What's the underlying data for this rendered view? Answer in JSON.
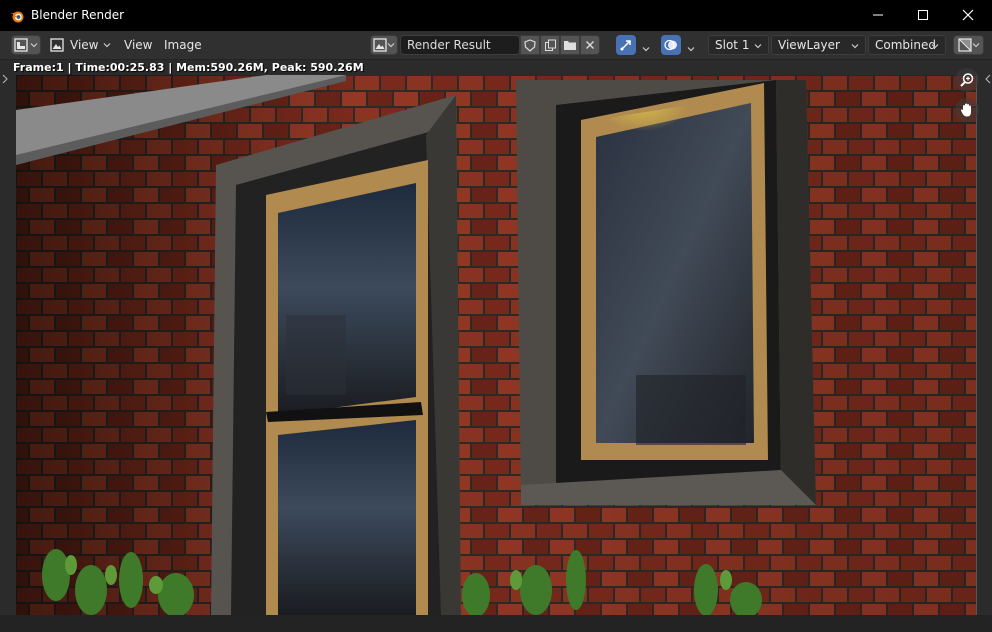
{
  "window": {
    "title": "Blender Render",
    "controls": [
      "minimize",
      "maximize",
      "close"
    ]
  },
  "header": {
    "editor_type_icon": "image-editor-icon",
    "view_mode_label": "View",
    "menus": [
      "View",
      "Image"
    ],
    "image_name": "Render Result",
    "slot": "Slot 1",
    "view_layer": "ViewLayer",
    "pass": "Combined"
  },
  "stats_text": "Frame:1 | Time:00:25.83 | Mem:590.26M, Peak: 590.26M",
  "colors": {
    "title_bar": "#000000",
    "header": "#303030",
    "accent_blue": "#4772b3",
    "viewport_bg": "#2b2b2b"
  },
  "icons": {
    "zoom": "zoom-icon",
    "pan": "hand-icon",
    "app": "blender-logo-icon"
  }
}
